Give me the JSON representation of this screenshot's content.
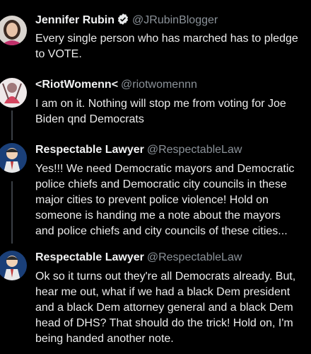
{
  "tweets": [
    {
      "name": "Jennifer Rubin",
      "handle": "@JRubinBlogger",
      "verified": true,
      "lines": [
        "Every single person who has marched has to pledge",
        "to VOTE."
      ]
    },
    {
      "name": "<RiotWomenn<",
      "handle": "@riotwomennn",
      "verified": false,
      "lines": [
        "I am on it.  Nothing will stop me from voting for Joe",
        "Biden qnd Democrats"
      ]
    },
    {
      "name": "Respectable Lawyer",
      "handle": "@RespectableLaw",
      "verified": false,
      "lines": [
        "Yes!!! We need Democratic mayors and Democratic",
        "police chiefs and Democratic city councils in these",
        "major cities to prevent police violence! Hold on",
        "someone is handing me a note about the mayors",
        "and police chiefs and city councils of these cities..."
      ]
    },
    {
      "name": "Respectable Lawyer",
      "handle": "@RespectableLaw",
      "verified": false,
      "lines": [
        "Ok so it turns out they're all Democrats already. But,",
        "hear me out, what if we had a black Dem president",
        "and a black Dem attorney general and a black Dem",
        "head of DHS? That should do the trick! Hold on, I'm",
        "being handed another note."
      ]
    }
  ],
  "colors": {
    "background": "#000000",
    "text": "#ececec",
    "handle": "#8b9299",
    "verified": "#e7e9ea"
  },
  "icons": {
    "verified": "verified-badge-icon"
  }
}
